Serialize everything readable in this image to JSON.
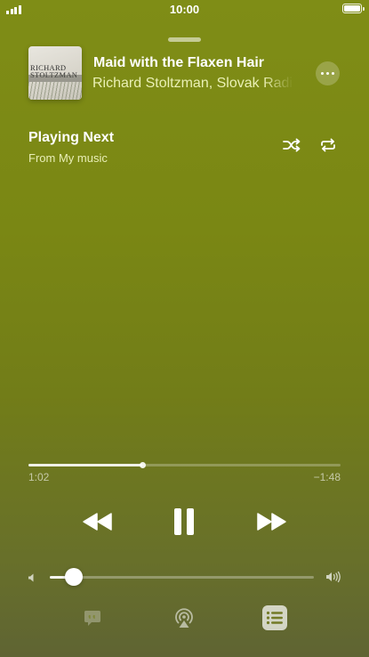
{
  "status_bar": {
    "time": "10:00"
  },
  "now_playing": {
    "title": "Maid with the Flaxen Hair",
    "artist": "Richard Stoltzman, Slovak Radio Symphony Orchestra",
    "artwork": {
      "line1": "RICHARD",
      "line2": "STOLTZMAN"
    }
  },
  "queue": {
    "heading": "Playing Next",
    "subheading": "From My music"
  },
  "playback": {
    "elapsed": "1:02",
    "remaining": "−1:48",
    "progress_fraction": 0.366,
    "is_playing": true
  },
  "volume": {
    "level_fraction": 0.09
  },
  "colors": {
    "background_top": "#7f8d16",
    "background_bottom": "#5f6433",
    "artist_tint": "#f0f5be"
  },
  "icons": {
    "more": "ellipsis-icon",
    "shuffle": "shuffle-icon",
    "repeat": "repeat-icon",
    "rewind": "rewind-icon",
    "pause": "pause-icon",
    "forward": "fast-forward-icon",
    "volume_low": "speaker-low-icon",
    "volume_high": "speaker-high-icon",
    "lyrics": "lyrics-icon",
    "airplay": "airplay-icon",
    "queue": "queue-list-icon"
  }
}
